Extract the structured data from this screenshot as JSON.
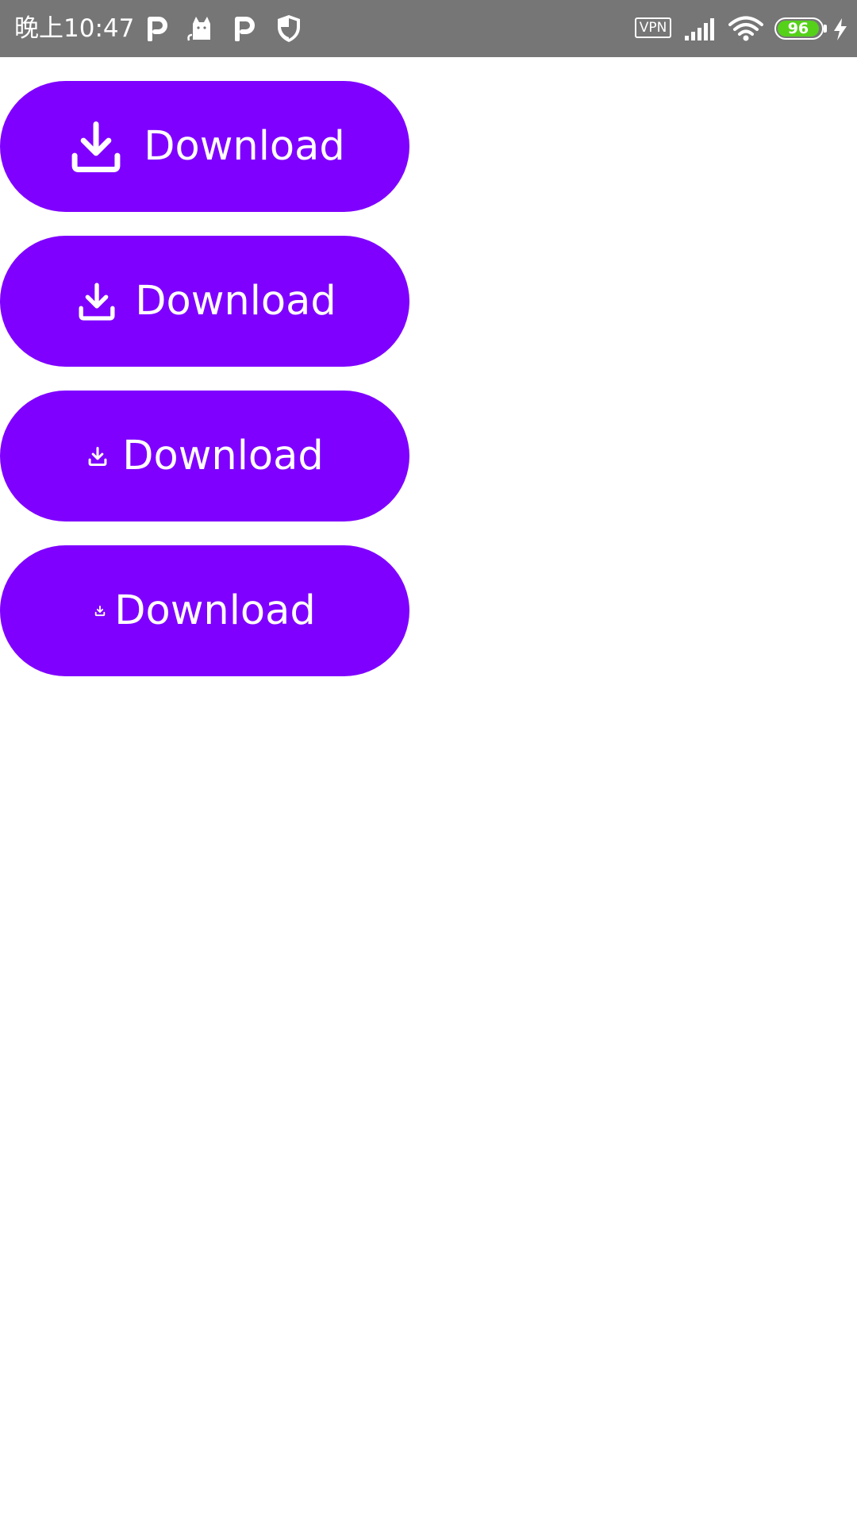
{
  "status_bar": {
    "time": "晚上10:47",
    "vpn_label": "VPN",
    "battery_percent": "96",
    "notification_icons": [
      "p-app-icon",
      "cat-app-icon",
      "p-app-icon",
      "shield-icon"
    ],
    "colors": {
      "background": "#767676",
      "foreground": "#ffffff",
      "battery_fill": "#55d11a"
    }
  },
  "buttons": [
    {
      "label": "Download",
      "icon": "download-icon"
    },
    {
      "label": "Download",
      "icon": "download-icon"
    },
    {
      "label": "Download",
      "icon": "download-icon"
    },
    {
      "label": "Download",
      "icon": "download-icon"
    }
  ],
  "colors": {
    "button_background": "#7f00ff",
    "button_text": "#ffffff",
    "page_background": "#ffffff"
  }
}
